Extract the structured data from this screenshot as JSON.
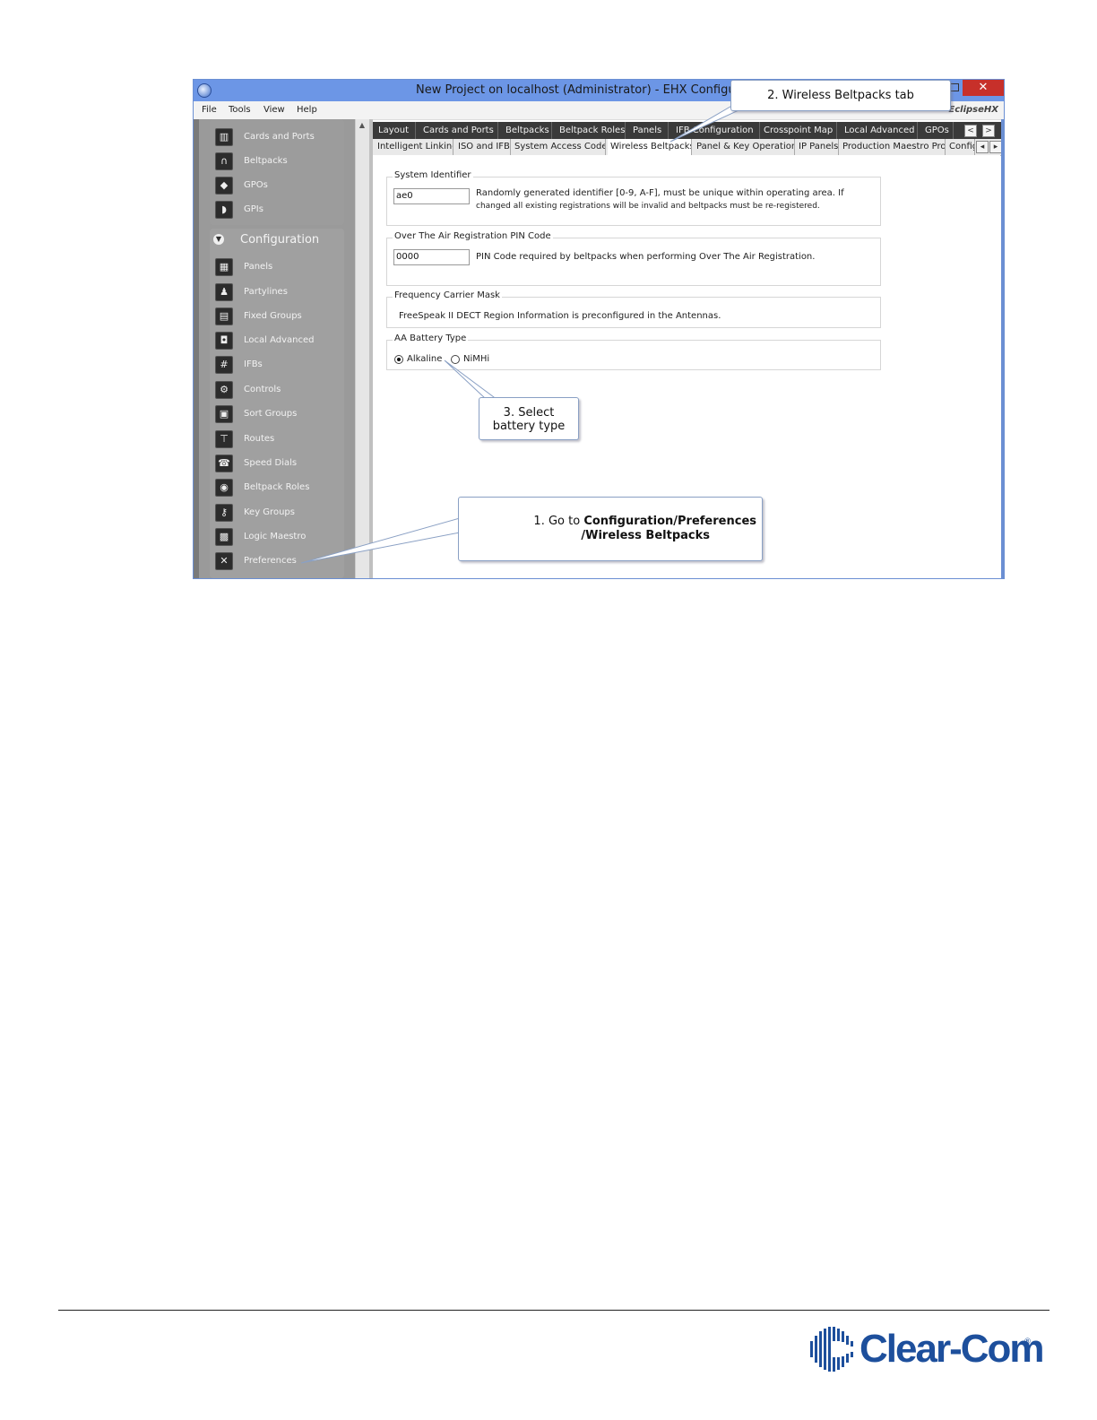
{
  "window": {
    "title": "New Project on localhost (Administrator) - EHX Configurati",
    "close_glyph": "✕",
    "brand": "EclipseHX"
  },
  "menu": [
    "File",
    "Tools",
    "View",
    "Help"
  ],
  "sidebar": {
    "top_items": [
      {
        "label": "Cards and Ports",
        "icon": "cards-icon",
        "glyph": "▥"
      },
      {
        "label": "Beltpacks",
        "icon": "headset-icon",
        "glyph": "∩"
      },
      {
        "label": "GPOs",
        "icon": "gpo-icon",
        "glyph": "◆"
      },
      {
        "label": "GPIs",
        "icon": "gpi-icon",
        "glyph": "◗"
      }
    ],
    "section_title": "Configuration",
    "section_glyph": "▼",
    "config_items": [
      {
        "label": "Panels",
        "icon": "panels-icon",
        "glyph": "▦"
      },
      {
        "label": "Partylines",
        "icon": "partylines-icon",
        "glyph": "♟"
      },
      {
        "label": "Fixed Groups",
        "icon": "fixed-groups-icon",
        "glyph": "▤"
      },
      {
        "label": "Local Advanced",
        "icon": "local-advanced-icon",
        "glyph": "◘"
      },
      {
        "label": "IFBs",
        "icon": "ifb-icon",
        "glyph": "#"
      },
      {
        "label": "Controls",
        "icon": "controls-icon",
        "glyph": "⚙"
      },
      {
        "label": "Sort Groups",
        "icon": "sort-groups-icon",
        "glyph": "▣"
      },
      {
        "label": "Routes",
        "icon": "routes-icon",
        "glyph": "⊤"
      },
      {
        "label": "Speed Dials",
        "icon": "speed-dials-icon",
        "glyph": "☎"
      },
      {
        "label": "Beltpack Roles",
        "icon": "beltpack-roles-icon",
        "glyph": "◉"
      },
      {
        "label": "Key Groups",
        "icon": "key-groups-icon",
        "glyph": "⚷"
      },
      {
        "label": "Logic Maestro",
        "icon": "logic-maestro-icon",
        "glyph": "▩"
      },
      {
        "label": "Preferences",
        "icon": "preferences-icon",
        "glyph": "✕"
      }
    ],
    "scroll_up_glyph": "▲"
  },
  "tabs_row1": [
    "Layout",
    "Cards and Ports",
    "Beltpacks",
    "Beltpack Roles",
    "Panels",
    "IFB Configuration",
    "Crosspoint Map",
    "Local Advanced",
    "GPOs"
  ],
  "tabs_row1_nav": [
    "<",
    ">"
  ],
  "tabs_row2": [
    "Intelligent Linking",
    "ISO and IFB",
    "System Access Codes",
    "Wireless Beltpacks",
    "Panel & Key Operation",
    "IP Panels",
    "Production Maestro Pro",
    "Config"
  ],
  "tabs_row2_nav": [
    "◂",
    "▸"
  ],
  "form": {
    "system_identifier": {
      "title": "System Identifier",
      "value": "ae0",
      "desc1": "Randomly generated identifier [0-9, A-F], must be unique within operating area.  If",
      "desc2": "changed all existing registrations will be invalid and beltpacks must be re-registered."
    },
    "pin": {
      "title": "Over The Air Registration PIN Code",
      "value": "0000",
      "desc": "PIN Code required by beltpacks when performing Over The Air Registration."
    },
    "freq": {
      "title": "Frequency Carrier Mask",
      "desc": "FreeSpeak II DECT Region Information is preconfigured in the Antennas."
    },
    "battery": {
      "title": "AA Battery Type",
      "options": [
        "Alkaline",
        "NiMHi"
      ],
      "selected": "Alkaline"
    }
  },
  "callouts": {
    "c1_prefix": "1. Go to ",
    "c1_bold1": "Configuration/Preferences",
    "c1_bold2": "/Wireless Beltpacks",
    "c2": "2. Wireless Beltpacks tab",
    "c3_line1": "3. Select",
    "c3_line2": "battery type"
  },
  "footer": {
    "logo_text": "Clear-Com",
    "reg": "®"
  },
  "colors": {
    "titlebar": "#6c96e6",
    "sidebar": "#9a9a9a",
    "tab_dark": "#3a3a3a",
    "logo": "#1d4f9c"
  }
}
